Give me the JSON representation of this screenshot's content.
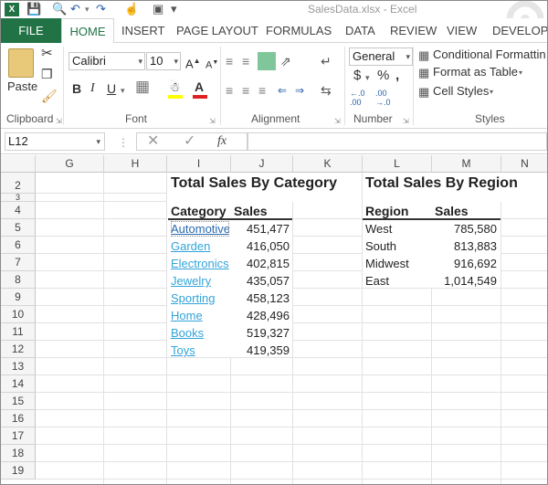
{
  "window": {
    "title": "SalesData.xlsx - Excel"
  },
  "tabs": [
    {
      "label": "FILE"
    },
    {
      "label": "HOME"
    },
    {
      "label": "INSERT"
    },
    {
      "label": "PAGE LAYOUT"
    },
    {
      "label": "FORMULAS"
    },
    {
      "label": "DATA"
    },
    {
      "label": "REVIEW"
    },
    {
      "label": "VIEW"
    },
    {
      "label": "DEVELOPE"
    }
  ],
  "ribbon": {
    "paste_label": "Paste",
    "font_name": "Calibri",
    "font_size": "10",
    "number_format": "General",
    "conditional_formatting": "Conditional Formattin",
    "format_as_table": "Format as Table",
    "cell_styles": "Cell Styles",
    "groups": [
      "Clipboard",
      "Font",
      "Alignment",
      "Number",
      "Styles"
    ]
  },
  "formula_bar": {
    "name_box": "L12",
    "fx": "fx",
    "value": ""
  },
  "columns": [
    "G",
    "H",
    "I",
    "J",
    "K",
    "L",
    "M",
    "N"
  ],
  "rows": [
    "2",
    "3",
    "4",
    "5",
    "6",
    "7",
    "8",
    "9",
    "10",
    "11",
    "12",
    "13",
    "14",
    "15",
    "16",
    "17",
    "18",
    "19"
  ],
  "category_table": {
    "title": "Total Sales By Category",
    "headers": [
      "Category",
      "Sales"
    ],
    "rows": [
      [
        "Automotive",
        "451,477"
      ],
      [
        "Garden",
        "416,050"
      ],
      [
        "Electronics",
        "402,815"
      ],
      [
        "Jewelry",
        "435,057"
      ],
      [
        "Sporting",
        "458,123"
      ],
      [
        "Home",
        "428,496"
      ],
      [
        "Books",
        "519,327"
      ],
      [
        "Toys",
        "419,359"
      ]
    ]
  },
  "region_table": {
    "title": "Total Sales By Region",
    "headers": [
      "Region",
      "Sales"
    ],
    "rows": [
      [
        "West",
        "785,580"
      ],
      [
        "South",
        "813,883"
      ],
      [
        "Midwest",
        "916,692"
      ],
      [
        "East",
        "1,014,549"
      ]
    ]
  },
  "colors": {
    "excel_green": "#217346",
    "link": "#33a4d9"
  }
}
